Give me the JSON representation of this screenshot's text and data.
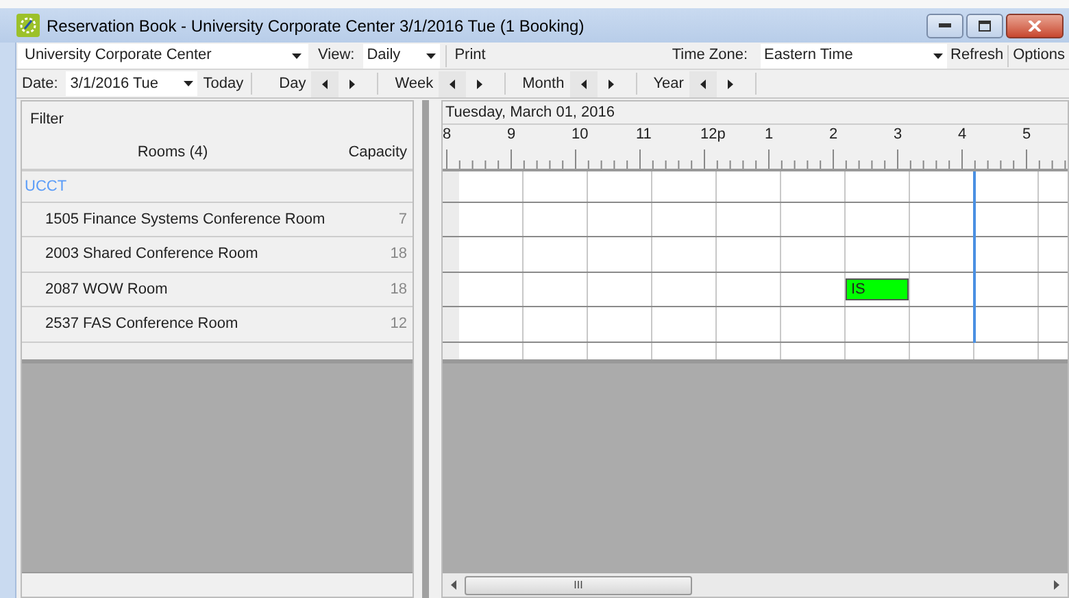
{
  "window": {
    "title": "Reservation Book - University Corporate Center 3/1/2016 Tue (1 Booking)"
  },
  "toolbar": {
    "location": "University Corporate Center",
    "view_label": "View:",
    "view": "Daily",
    "print": "Print",
    "time_zone_label": "Time Zone:",
    "time_zone": "Eastern Time",
    "refresh": "Refresh",
    "options": "Options"
  },
  "navbar": {
    "date_label": "Date:",
    "date": "3/1/2016 Tue",
    "today": "Today",
    "steps": [
      "Day",
      "Week",
      "Month",
      "Year"
    ]
  },
  "rooms_panel": {
    "filter": "Filter",
    "rooms_header": "Rooms (4)",
    "capacity_header": "Capacity",
    "group": "UCCT",
    "rooms": [
      {
        "name": "1505 Finance Systems Conference Room",
        "capacity": "7",
        "slots": [
          {
            "booked": false
          },
          {
            "booked": false
          },
          {
            "booked": false
          },
          {
            "booked": false
          },
          {
            "booked": false
          },
          {
            "booked": false
          },
          {
            "booked": false
          },
          {
            "booked": false
          },
          {
            "booked": false
          },
          {
            "booked": false
          }
        ]
      },
      {
        "name": "2003 Shared Conference Room",
        "capacity": "18",
        "slots": [
          {
            "booked": false
          },
          {
            "booked": false
          },
          {
            "booked": false
          },
          {
            "booked": false
          },
          {
            "booked": false
          },
          {
            "booked": false
          },
          {
            "booked": false
          },
          {
            "booked": false
          },
          {
            "booked": false
          },
          {
            "booked": false
          }
        ]
      },
      {
        "name": "2087 WOW Room",
        "capacity": "18",
        "slots": [
          {
            "booked": false
          },
          {
            "booked": false
          },
          {
            "booked": false
          },
          {
            "booked": false
          },
          {
            "booked": false
          },
          {
            "booked": false
          },
          {
            "booked": true,
            "label": "IS"
          },
          {
            "booked": false
          },
          {
            "booked": false
          },
          {
            "booked": false
          }
        ]
      },
      {
        "name": "2537 FAS Conference Room",
        "capacity": "12",
        "slots": [
          {
            "booked": false
          },
          {
            "booked": false
          },
          {
            "booked": false
          },
          {
            "booked": false
          },
          {
            "booked": false
          },
          {
            "booked": false
          },
          {
            "booked": false
          },
          {
            "booked": false
          },
          {
            "booked": false
          },
          {
            "booked": false
          }
        ]
      }
    ]
  },
  "schedule": {
    "date_header": "Tuesday, March 01, 2016",
    "hours": [
      {
        "label": "8",
        "now": false
      },
      {
        "label": "9",
        "now": false
      },
      {
        "label": "10",
        "now": false
      },
      {
        "label": "11",
        "now": false
      },
      {
        "label": "12p",
        "now": false
      },
      {
        "label": "1",
        "now": false
      },
      {
        "label": "2",
        "now": false
      },
      {
        "label": "3",
        "now": false
      },
      {
        "label": "4",
        "now": true
      },
      {
        "label": "5",
        "now": false
      }
    ],
    "scrollbar_grip": "III"
  }
}
